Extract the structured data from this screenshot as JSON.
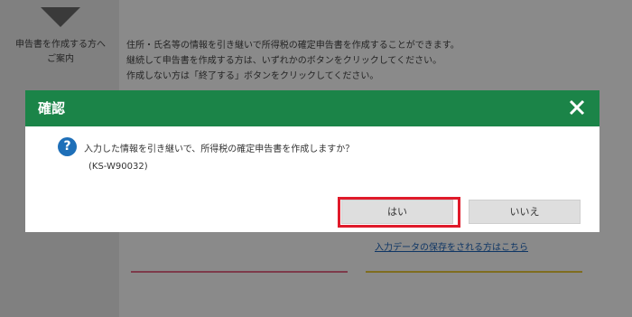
{
  "background": {
    "left_text_line1": "申告書を作成する方へ",
    "left_text_line2": "ご案内",
    "desc_lines": [
      "住所・氏名等の情報を引き継いで所得税の確定申告書を作成することができます。",
      "継続して申告書を作成する方は、いずれかのボタンをクリックしてください。",
      "作成しない方は「終了する」ボタンをクリックしてください。"
    ],
    "link_text": "入力データの保存をされる方はこちら"
  },
  "dialog": {
    "title": "確認",
    "message": "入力した情報を引き継いで、所得税の確定申告書を作成しますか？",
    "code": "(KS-W90032)",
    "yes_label": "はい",
    "no_label": "いいえ"
  },
  "colors": {
    "header_bg": "#1b8448",
    "highlight": "#e01a2a",
    "question_icon": "#1e6fb8"
  }
}
